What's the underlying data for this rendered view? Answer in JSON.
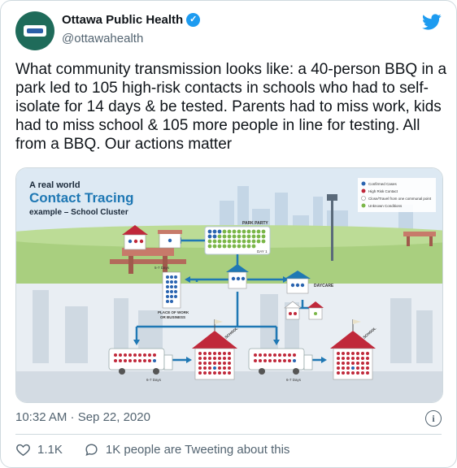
{
  "account": {
    "name": "Ottawa Public Health",
    "handle": "@ottawahealth"
  },
  "tweet": {
    "text": "What community transmission looks like: a 40-person BBQ in a park led to 105 high-risk contacts in schools who had to self-isolate for 14 days & be tested. Parents had to miss work, kids had to miss school & 105 more people in line for testing. All from a BBQ. Our actions matter",
    "timestamp": "10:32 AM · Sep 22, 2020",
    "likes": "1.1K",
    "tweeting": "1K people are Tweeting about this"
  },
  "infographic": {
    "kicker": "A real world",
    "title": "Contact Tracing",
    "subtitle": "example – School Cluster",
    "park_party": "PARK PARTY",
    "day1": "DAY 1",
    "days_5_7": "5-7 Days",
    "place_of_work": "PLACE OF WORK",
    "or_business": "OR BUSINESS",
    "daycare": "DAYCARE",
    "school": "SCHOOL",
    "days_6_7": "6-7 Days",
    "legend": [
      "Confirmed Cases",
      "High Risk Contact",
      "Close/Travel from one communal point",
      "Unknown Conditions"
    ]
  },
  "colors": {
    "accent": "#1d9bf0",
    "confirmed": "#2a64b0",
    "high_risk": "#c0283a",
    "unknown": "#7ab648",
    "sky": "#dde9f3"
  },
  "icons": [
    "twitter-bird-icon",
    "verified-badge-icon",
    "info-icon",
    "heart-icon",
    "chat-bubble-icon"
  ]
}
